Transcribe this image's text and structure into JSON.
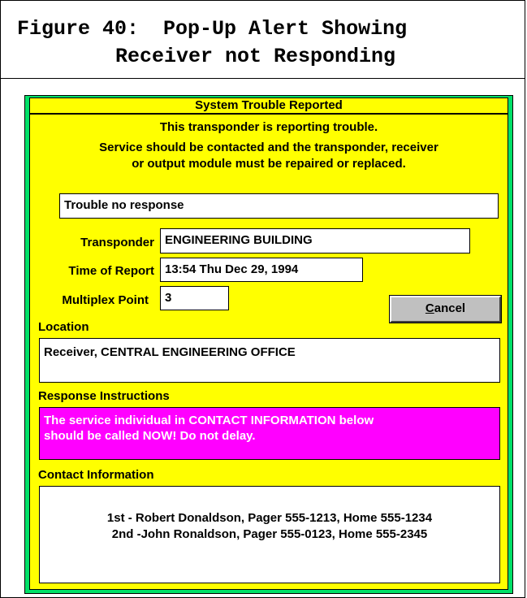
{
  "caption": {
    "line1": "Figure 40:  Pop-Up Alert Showing",
    "line2": "Receiver not Responding"
  },
  "dialog": {
    "title": "System Trouble Reported",
    "message_line1": "This transponder is reporting trouble.",
    "message_line2": "Service should be contacted and the transponder, receiver",
    "message_line3": "or output module must be repaired or replaced.",
    "trouble_status": "Trouble no response",
    "transponder_label": "Transponder",
    "transponder_value": "ENGINEERING BUILDING",
    "time_label": "Time of Report",
    "time_value": "13:54 Thu Dec 29, 1994",
    "multiplex_label": "Multiplex Point",
    "multiplex_value": "3",
    "cancel_label_underlined": "C",
    "cancel_label_rest": "ancel",
    "location_label": "Location",
    "location_value": "Receiver, CENTRAL ENGINEERING OFFICE",
    "instructions_label": "Response Instructions",
    "instructions_line1": "The service individual in CONTACT INFORMATION below",
    "instructions_line2": "should be called NOW! Do not delay.",
    "contact_label": "Contact Information",
    "contact_line1": "1st - Robert Donaldson, Pager 555-1213, Home 555-1234",
    "contact_line2": "2nd -John Ronaldson, Pager 555-0123, Home 555-2345"
  },
  "colors": {
    "dialog_border": "#00e068",
    "dialog_body": "#ffff00",
    "instructions_bg": "#ff00ff",
    "instructions_text": "#ffffff",
    "button_face": "#c0c0c0"
  }
}
